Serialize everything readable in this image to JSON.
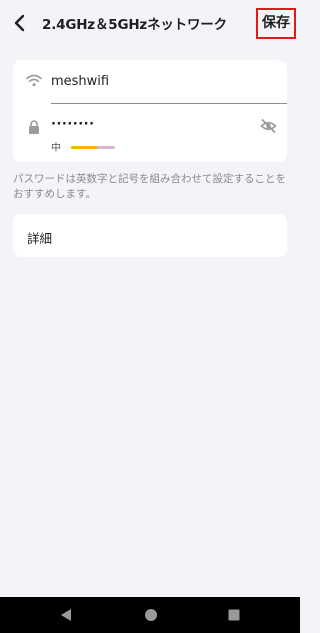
{
  "header": {
    "title": "2.4GHz＆5GHzネットワーク",
    "save_label": "保存"
  },
  "network": {
    "ssid": "meshwifi",
    "password_masked": "········",
    "strength_label": "中",
    "strength_level": 0.6
  },
  "hint_text": "パスワードは英数字と記号を組み合わせて設定することをおすすめします。",
  "details_label": "詳細",
  "colors": {
    "background": "#F2F4F8",
    "save_highlight": "#E01919",
    "strength_fill": "#F2B705",
    "strength_track": "#D9B7D0"
  }
}
